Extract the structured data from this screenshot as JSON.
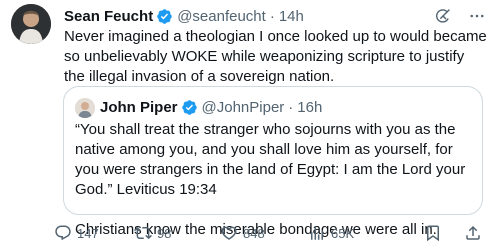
{
  "author": {
    "name": "Sean Feucht",
    "handle": "@seanfeucht",
    "time": "14h"
  },
  "tweet_text": "Never imagined a theologian I once looked up to would became so unbelievably WOKE while weaponizing scripture to justify the illegal invasion of a sovereign nation.",
  "quoted": {
    "name": "John Piper",
    "handle": "@JohnPiper",
    "time": "16h",
    "paragraph1": "“You shall treat the stranger who sojourns with you as the native among you, and you shall love him as yourself, for you were strangers in the land of Egypt: I am the Lord your God.” Leviticus 19:34",
    "paragraph2": "Christians know the miserable bondage we were all in."
  },
  "separator": "·",
  "actions": {
    "replies": "147",
    "reposts": "98",
    "likes": "848",
    "views": "65K"
  },
  "colors": {
    "text": "#0f1419",
    "secondary": "#536471",
    "border": "#cfd9de",
    "verified": "#1d9bf0"
  },
  "icons": {
    "grok": "grok-icon",
    "more": "more-icon",
    "verified": "verified-badge-icon",
    "reply": "reply-icon",
    "repost": "repost-icon",
    "like": "heart-icon",
    "views": "views-icon",
    "bookmark": "bookmark-icon",
    "share": "share-icon"
  }
}
